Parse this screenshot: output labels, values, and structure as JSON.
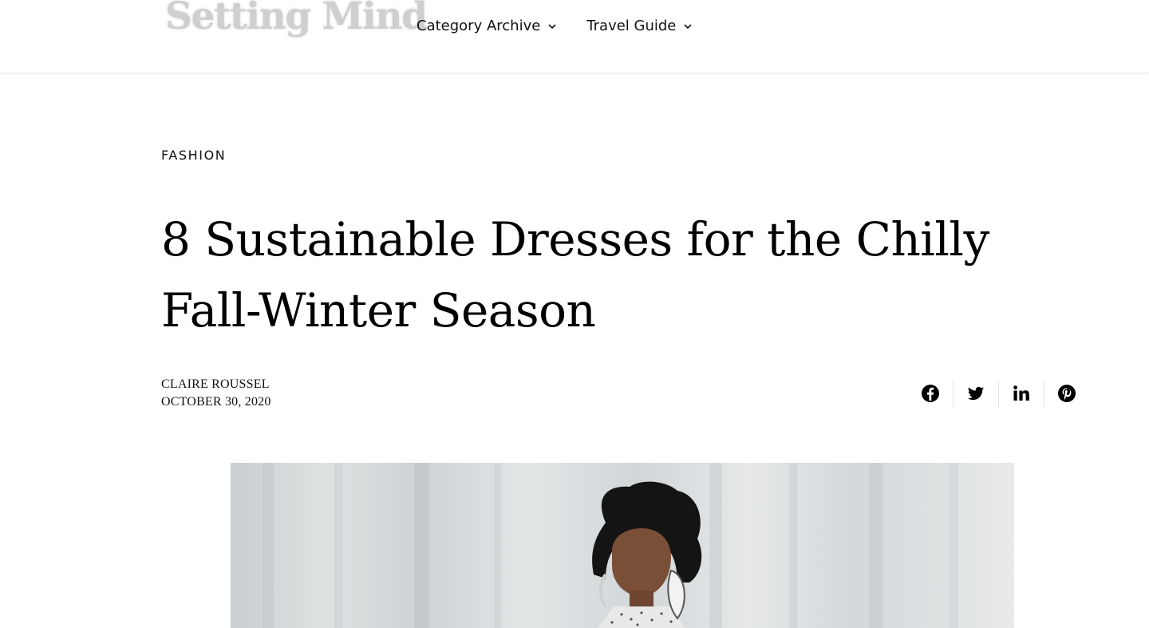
{
  "header": {
    "logo_text": "Setting Mind",
    "nav": [
      {
        "label": "Category Archive"
      },
      {
        "label": "Travel Guide"
      }
    ]
  },
  "article": {
    "category": "FASHION",
    "title": "8 Sustainable Dresses for the Chilly Fall-Winter Season",
    "author": "CLAIRE ROUSSEL",
    "date": "OCTOBER 30, 2020"
  },
  "share": {
    "icons": [
      "facebook-icon",
      "twitter-icon",
      "linkedin-icon",
      "pinterest-icon"
    ]
  },
  "colors": {
    "logo": "#cfcfcf",
    "text": "#000000",
    "divider": "#e6e6e6"
  }
}
